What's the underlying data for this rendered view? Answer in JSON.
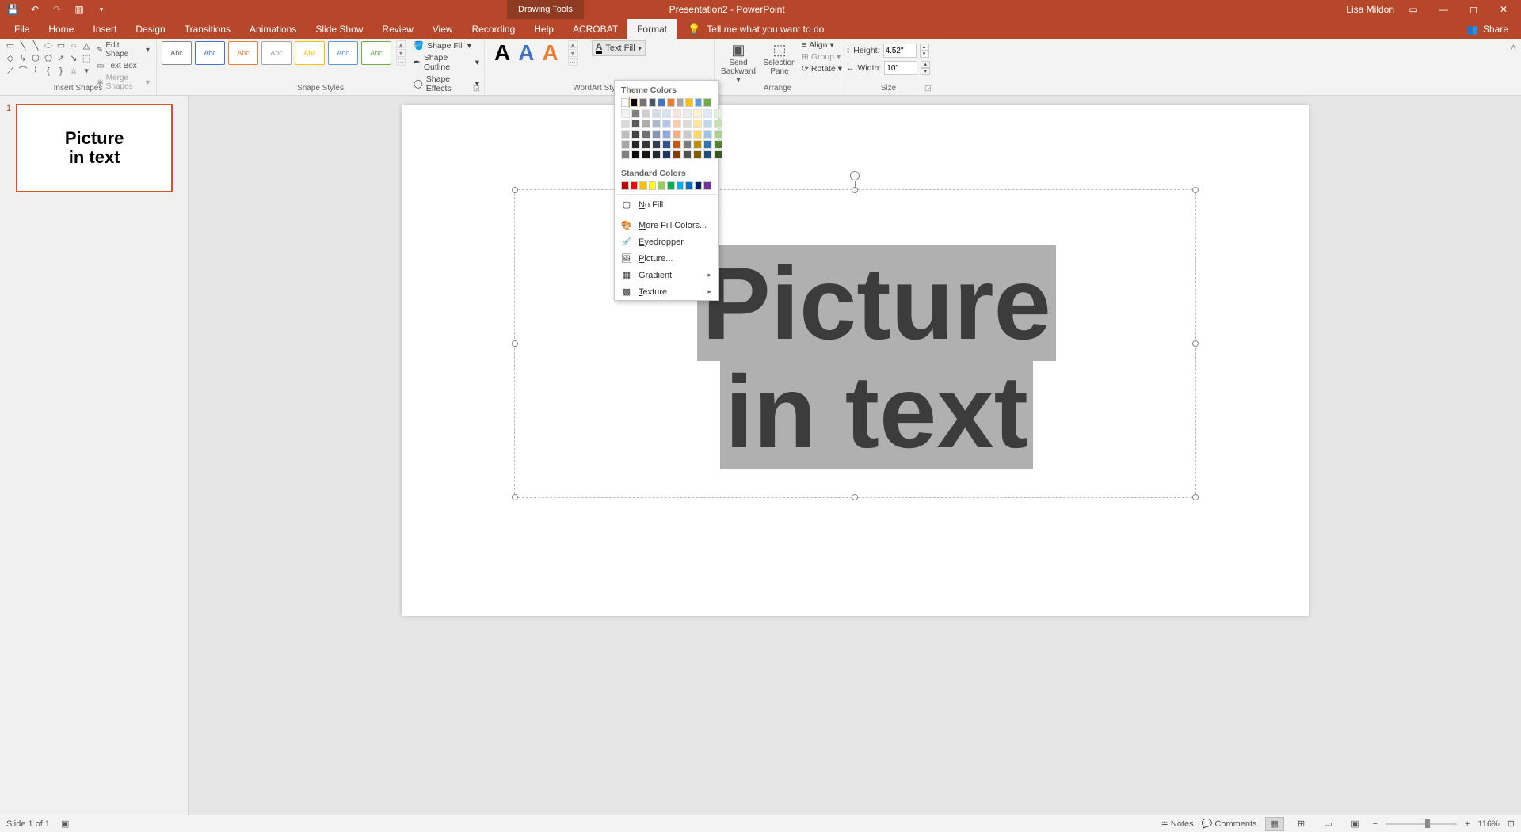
{
  "titlebar": {
    "doc_title": "Presentation2 - PowerPoint",
    "context_tab": "Drawing Tools",
    "user": "Lisa Mildon"
  },
  "tabs": {
    "file": "File",
    "home": "Home",
    "insert": "Insert",
    "design": "Design",
    "transitions": "Transitions",
    "animations": "Animations",
    "slideshow": "Slide Show",
    "review": "Review",
    "view": "View",
    "recording": "Recording",
    "help": "Help",
    "acrobat": "ACROBAT",
    "format": "Format",
    "tellme": "Tell me what you want to do",
    "share": "Share"
  },
  "groups": {
    "insert_shapes": "Insert Shapes",
    "shape_styles": "Shape Styles",
    "wordart_styles": "WordArt Styles",
    "arrange": "Arrange",
    "size": "Size"
  },
  "insert_shapes": {
    "edit_shape": "Edit Shape",
    "text_box": "Text Box",
    "merge_shapes": "Merge Shapes"
  },
  "shape_styles": {
    "abc": "Abc",
    "shape_fill": "Shape Fill",
    "shape_outline": "Shape Outline",
    "shape_effects": "Shape Effects"
  },
  "wordart": {
    "text_fill": "Text Fill"
  },
  "arrange": {
    "send_backward": "Send Backward",
    "selection_pane": "Selection Pane",
    "align": "Align",
    "group": "Group",
    "rotate": "Rotate"
  },
  "size": {
    "height_label": "Height:",
    "width_label": "Width:",
    "height_value": "4.52\"",
    "width_value": "10\""
  },
  "dropdown": {
    "theme_colors": "Theme Colors",
    "standard_colors": "Standard Colors",
    "no_fill": "No Fill",
    "more_fill": "More Fill Colors...",
    "eyedropper": "Eyedropper",
    "picture": "Picture...",
    "gradient": "Gradient",
    "texture": "Texture",
    "theme_row": [
      "#ffffff",
      "#000000",
      "#767171",
      "#44546a",
      "#4472c4",
      "#ed7d31",
      "#a5a5a5",
      "#ffc000",
      "#5b9bd5",
      "#70ad47"
    ],
    "tints": [
      [
        "#f2f2f2",
        "#7f7f7f",
        "#d0cece",
        "#d6dce5",
        "#d9e2f3",
        "#fbe5d6",
        "#ededed",
        "#fff2cc",
        "#deebf7",
        "#e2f0d9"
      ],
      [
        "#d9d9d9",
        "#595959",
        "#aeabab",
        "#adb9ca",
        "#b4c7e7",
        "#f8cbad",
        "#dbdbdb",
        "#ffe699",
        "#bdd7ee",
        "#c5e0b4"
      ],
      [
        "#bfbfbf",
        "#404040",
        "#757171",
        "#8497b0",
        "#8faadc",
        "#f4b183",
        "#c9c9c9",
        "#ffd966",
        "#9dc3e6",
        "#a9d18e"
      ],
      [
        "#a6a6a6",
        "#262626",
        "#3b3838",
        "#333f50",
        "#2f5597",
        "#c55a11",
        "#7b7b7b",
        "#bf9000",
        "#2e75b6",
        "#548235"
      ],
      [
        "#7f7f7f",
        "#0d0d0d",
        "#181717",
        "#222a35",
        "#1f3864",
        "#843c0c",
        "#525252",
        "#7f6000",
        "#1f4e79",
        "#385723"
      ]
    ],
    "standard_row": [
      "#c00000",
      "#ff0000",
      "#ffc000",
      "#ffff00",
      "#92d050",
      "#00b050",
      "#00b0f0",
      "#0070c0",
      "#002060",
      "#7030a0"
    ]
  },
  "slide": {
    "line1": "Picture",
    "line2": "in text"
  },
  "thumb": {
    "number": "1",
    "line1": "Picture",
    "line2": "in text"
  },
  "status": {
    "slide_of": "Slide 1 of 1",
    "notes": "Notes",
    "comments": "Comments",
    "zoom": "116%"
  }
}
